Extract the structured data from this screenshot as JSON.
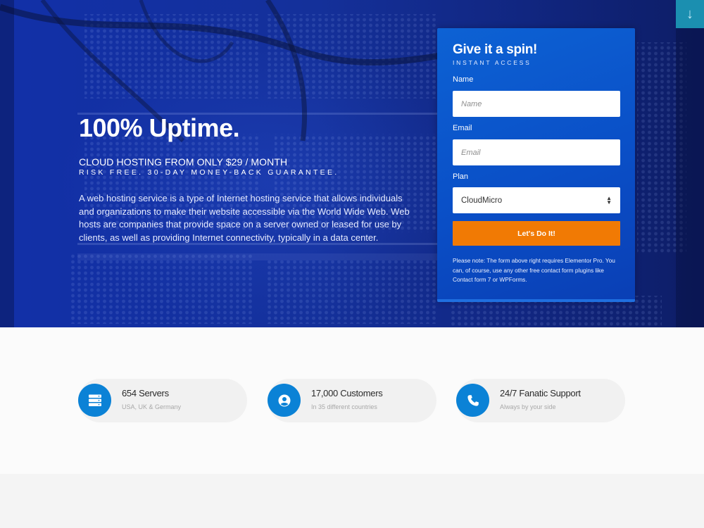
{
  "hero": {
    "title": "100% Uptime.",
    "subtitle": "CLOUD HOSTING FROM ONLY $29 / MONTH",
    "tagline": "RISK FREE. 30-DAY MONEY-BACK GUARANTEE.",
    "description": "A web hosting service is a type of Internet hosting service that allows individuals and organizations to make their website accessible via the World Wide Web. Web hosts are companies that provide space on a server owned or leased for use by clients, as well as providing Internet connectivity, typically in a data center."
  },
  "scroll_button": {
    "icon": "arrow-down-icon",
    "glyph": "↓"
  },
  "form": {
    "title": "Give it a spin!",
    "subtitle": "INSTANT ACCESS",
    "name_label": "Name",
    "name_placeholder": "Name",
    "email_label": "Email",
    "email_placeholder": "Email",
    "plan_label": "Plan",
    "plan_value": "CloudMicro",
    "submit_label": "Let's Do It!",
    "note": "Please note: The form above right requires Elementor Pro. You can, of course, use any other free contact form plugins like Contact form 7 or WPForms."
  },
  "stats": [
    {
      "icon": "server-icon",
      "title": "654 Servers",
      "desc": "USA, UK & Germany"
    },
    {
      "icon": "user-icon",
      "title": "17,000 Customers",
      "desc": "In 35 different countries"
    },
    {
      "icon": "phone-icon",
      "title": "24/7 Fanatic Support",
      "desc": "Always by your side"
    }
  ],
  "colors": {
    "accent": "#f17a04",
    "form_blue": "#0a4fc7",
    "icon_blue": "#0b82d6",
    "hero_blue": "#1230a8"
  }
}
